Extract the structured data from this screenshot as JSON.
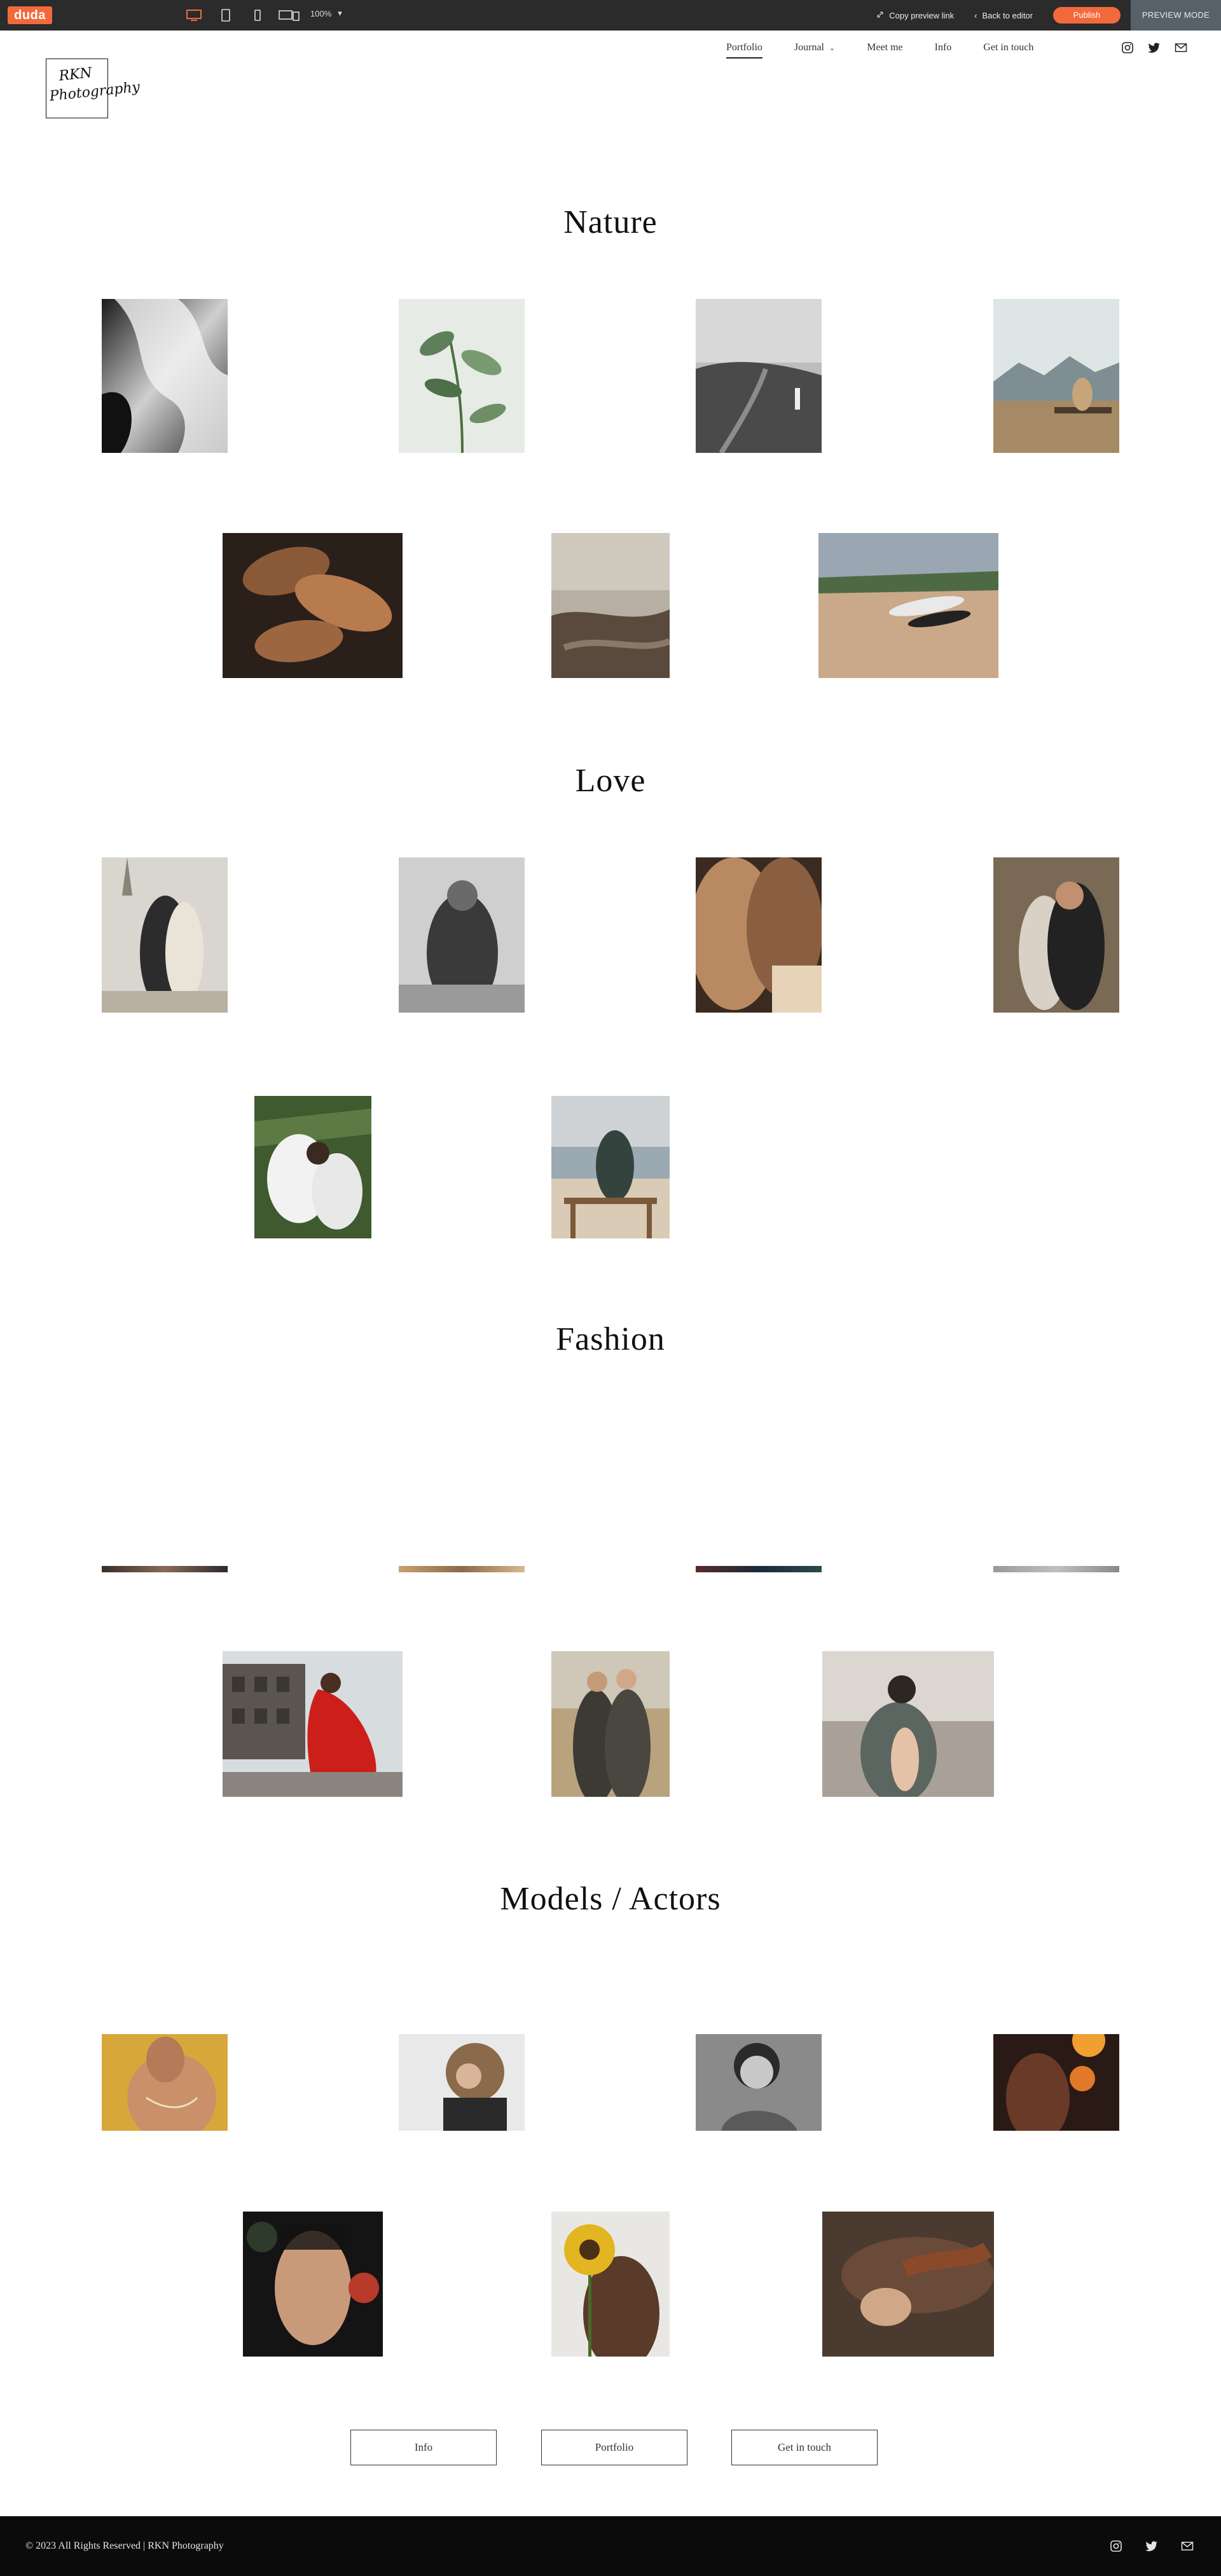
{
  "editor_bar": {
    "logo": "duda",
    "zoom": "100%",
    "copy_link": "Copy preview link",
    "back": "Back to editor",
    "publish": "Publish",
    "mode": "PREVIEW MODE",
    "accent": "#f26a3c"
  },
  "header": {
    "logo_line1": "RKN",
    "logo_line2": "Photography",
    "nav": [
      "Portfolio",
      "Journal",
      "Meet me",
      "Info",
      "Get in touch"
    ],
    "social_icons": [
      "instagram-icon",
      "twitter-icon",
      "mail-icon"
    ]
  },
  "sections": {
    "nature": "Nature",
    "love": "Love",
    "fashion": "Fashion",
    "models": "Models / Actors"
  },
  "buttons": {
    "info": "Info",
    "portfolio": "Portfolio",
    "contact": "Get in touch"
  },
  "footer": {
    "copyright": "© 2023 All Rights Reserved | RKN Photography"
  }
}
